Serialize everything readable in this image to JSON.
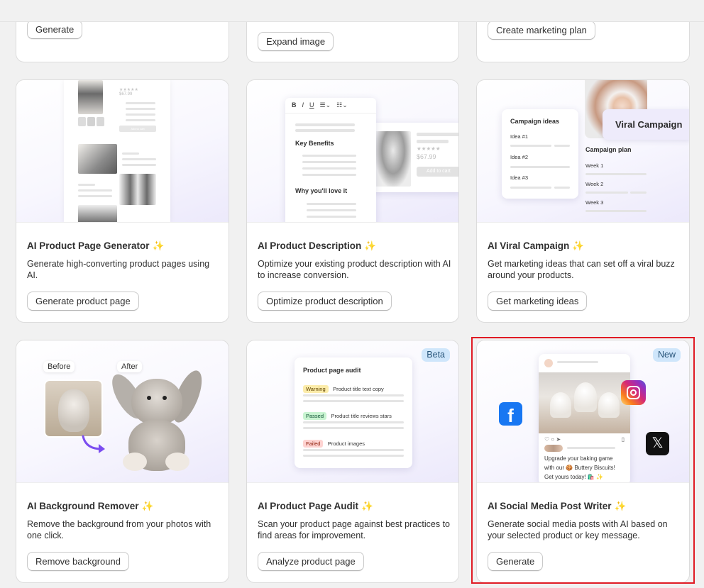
{
  "colors": {
    "accent": "#e01b24",
    "spark": "#f1b21c",
    "badge_bg": "#cfe6fb"
  },
  "top_row": {
    "buttons": [
      "Generate",
      "Expand image",
      "Create marketing plan"
    ]
  },
  "cards": [
    {
      "title": "AI Product Page Generator",
      "spark": "✨",
      "description": "Generate high-converting product pages using AI.",
      "button": "Generate product page",
      "preview": {
        "price": "$67.99",
        "stars": "★★★★★",
        "cart": "Add to cart"
      }
    },
    {
      "title": "AI Product Description",
      "spark": "✨",
      "description": "Optimize your existing product description with AI to increase conversion.",
      "button": "Optimize product description",
      "preview": {
        "toolbar": [
          "B",
          "I",
          "U",
          "☰⌄",
          "☷⌄"
        ],
        "heading1": "Key Benefits",
        "heading2": "Why you'll love it",
        "price": "$67.99",
        "stars": "★★★★★",
        "cart": "Add to cart"
      }
    },
    {
      "title": "AI Viral Campaign",
      "spark": "✨",
      "description": "Get marketing ideas that can set off a viral buzz around your products.",
      "button": "Get marketing ideas",
      "preview": {
        "ideas_title": "Campaign ideas",
        "ideas": [
          "Idea #1",
          "Idea #2",
          "Idea #3"
        ],
        "tag": "Viral Campaign",
        "plan_title": "Campaign plan",
        "weeks": [
          "Week 1",
          "Week 2",
          "Week 3"
        ]
      }
    },
    {
      "title": "AI Background Remover",
      "spark": "✨",
      "description": "Remove the background from your photos with one click.",
      "button": "Remove background",
      "preview": {
        "before": "Before",
        "after": "After"
      }
    },
    {
      "title": "AI Product Page Audit",
      "spark": "✨",
      "description": "Scan your product page against best practices to find areas for improvement.",
      "button": "Analyze product page",
      "badge": "Beta",
      "preview": {
        "audit_title": "Product page audit",
        "rows": [
          {
            "status": "Warning",
            "text": "Product title text copy",
            "bg": "#fcecaa",
            "fg": "#5e4200"
          },
          {
            "status": "Passed",
            "text": "Product title reviews stars",
            "bg": "#c9f4d1",
            "fg": "#0c5132"
          },
          {
            "status": "Failed",
            "text": "Product images",
            "bg": "#fed3d1",
            "fg": "#8e1f0b"
          }
        ]
      }
    },
    {
      "title": "AI Social Media Post Writer",
      "spark": "✨",
      "description": "Generate social media posts with AI based on your selected product or key message.",
      "button": "Generate",
      "badge": "New",
      "preview": {
        "post_lines": [
          "Upgrade your baking game",
          "with our 🍪 Buttery Biscuits!",
          "Get yours today! 🛍️ ✨"
        ],
        "facebook": "f",
        "x": "𝕏"
      }
    }
  ]
}
